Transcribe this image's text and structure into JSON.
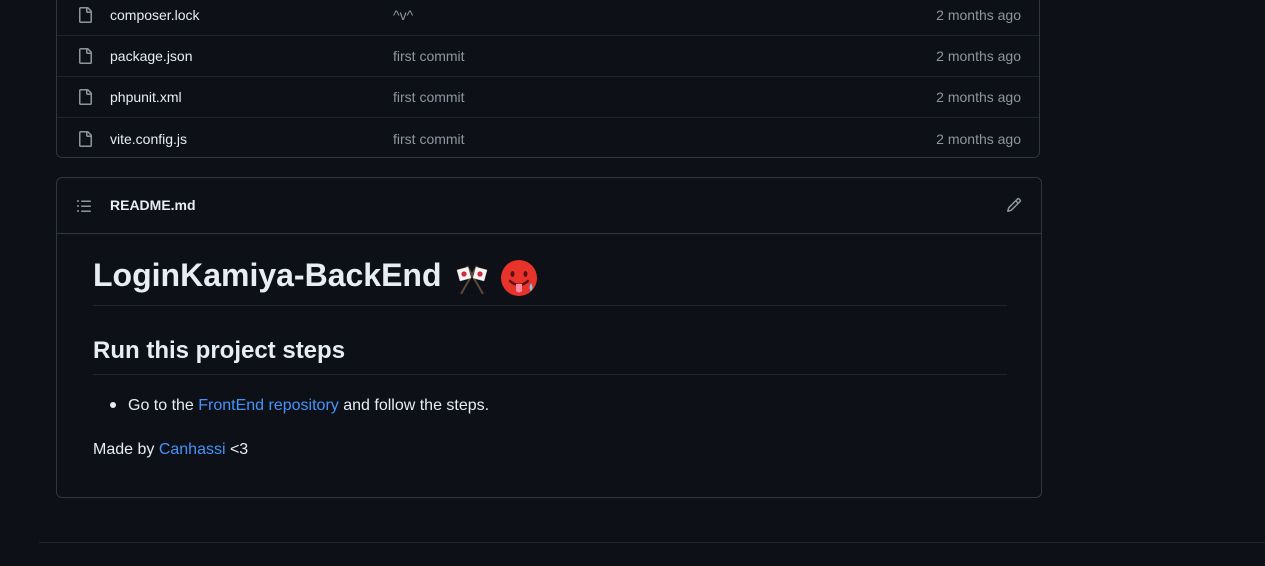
{
  "files": [
    {
      "name": "composer.lock",
      "commit": "^v^",
      "time": "2 months ago"
    },
    {
      "name": "package.json",
      "commit": "first commit",
      "time": "2 months ago"
    },
    {
      "name": "phpunit.xml",
      "commit": "first commit",
      "time": "2 months ago"
    },
    {
      "name": "vite.config.js",
      "commit": "first commit",
      "time": "2 months ago"
    }
  ],
  "readme": {
    "filename": "README.md",
    "h1": "LoginKamiya-BackEnd",
    "h2": "Run this project steps",
    "bullet": {
      "before": "Go to the ",
      "link": "FrontEnd repository",
      "after": " and follow the steps."
    },
    "made_by": {
      "before": "Made by ",
      "link": "Canhassi",
      "after": " <3"
    }
  },
  "icons": {
    "file": "file-icon",
    "list": "list-unordered-icon",
    "edit": "pencil-icon",
    "emoji1": "crossed-flags-emoji",
    "emoji2": "hot-face-emoji"
  },
  "colors": {
    "background": "#0d1117",
    "text": "#e6edf3",
    "muted": "#8d96a0",
    "link": "#4493f8",
    "border": "#30363d"
  }
}
